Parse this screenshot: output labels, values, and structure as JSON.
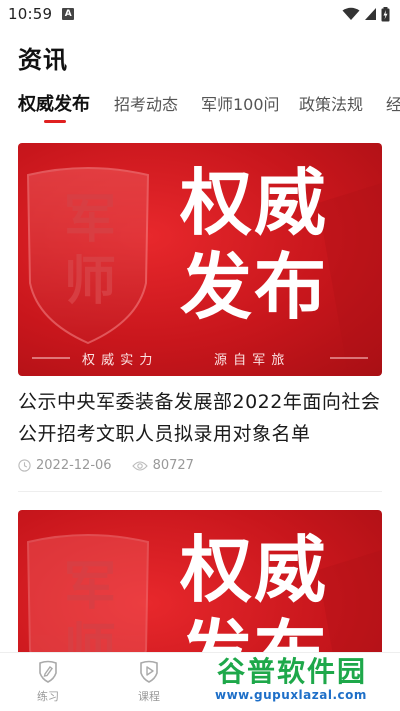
{
  "status_bar": {
    "time": "10:59",
    "app_icon_letter": "A",
    "icons": [
      "wifi-icon",
      "signal-icon",
      "battery-charging-icon"
    ]
  },
  "page": {
    "title": "资讯"
  },
  "tabs": [
    {
      "label": "权威发布",
      "active": true
    },
    {
      "label": "招考动态",
      "active": false
    },
    {
      "label": "军师100问",
      "active": false
    },
    {
      "label": "政策法规",
      "active": false
    },
    {
      "label": "经",
      "active": false
    }
  ],
  "banner": {
    "logo_text": "军师",
    "headline_line1": "权威",
    "headline_line2": "发布",
    "slogan_left": "权 威 实 力",
    "slogan_right": "源 自 军 旅"
  },
  "articles": [
    {
      "title": "公示中央军委装备发展部2022年面向社会公开招考文职人员拟录用对象名单",
      "date": "2022-12-06",
      "views": "80727"
    }
  ],
  "bottom_nav": [
    {
      "label": "练习",
      "icon": "pencil-shield-icon"
    },
    {
      "label": "课程",
      "icon": "play-shield-icon"
    }
  ],
  "watermark": {
    "title": "谷普软件园",
    "url": "www.gupuxlazal.com"
  },
  "colors": {
    "accent": "#e02020",
    "banner_red": "#c8161c",
    "watermark_green": "#1ea84a",
    "watermark_blue": "#1e6fc8"
  }
}
